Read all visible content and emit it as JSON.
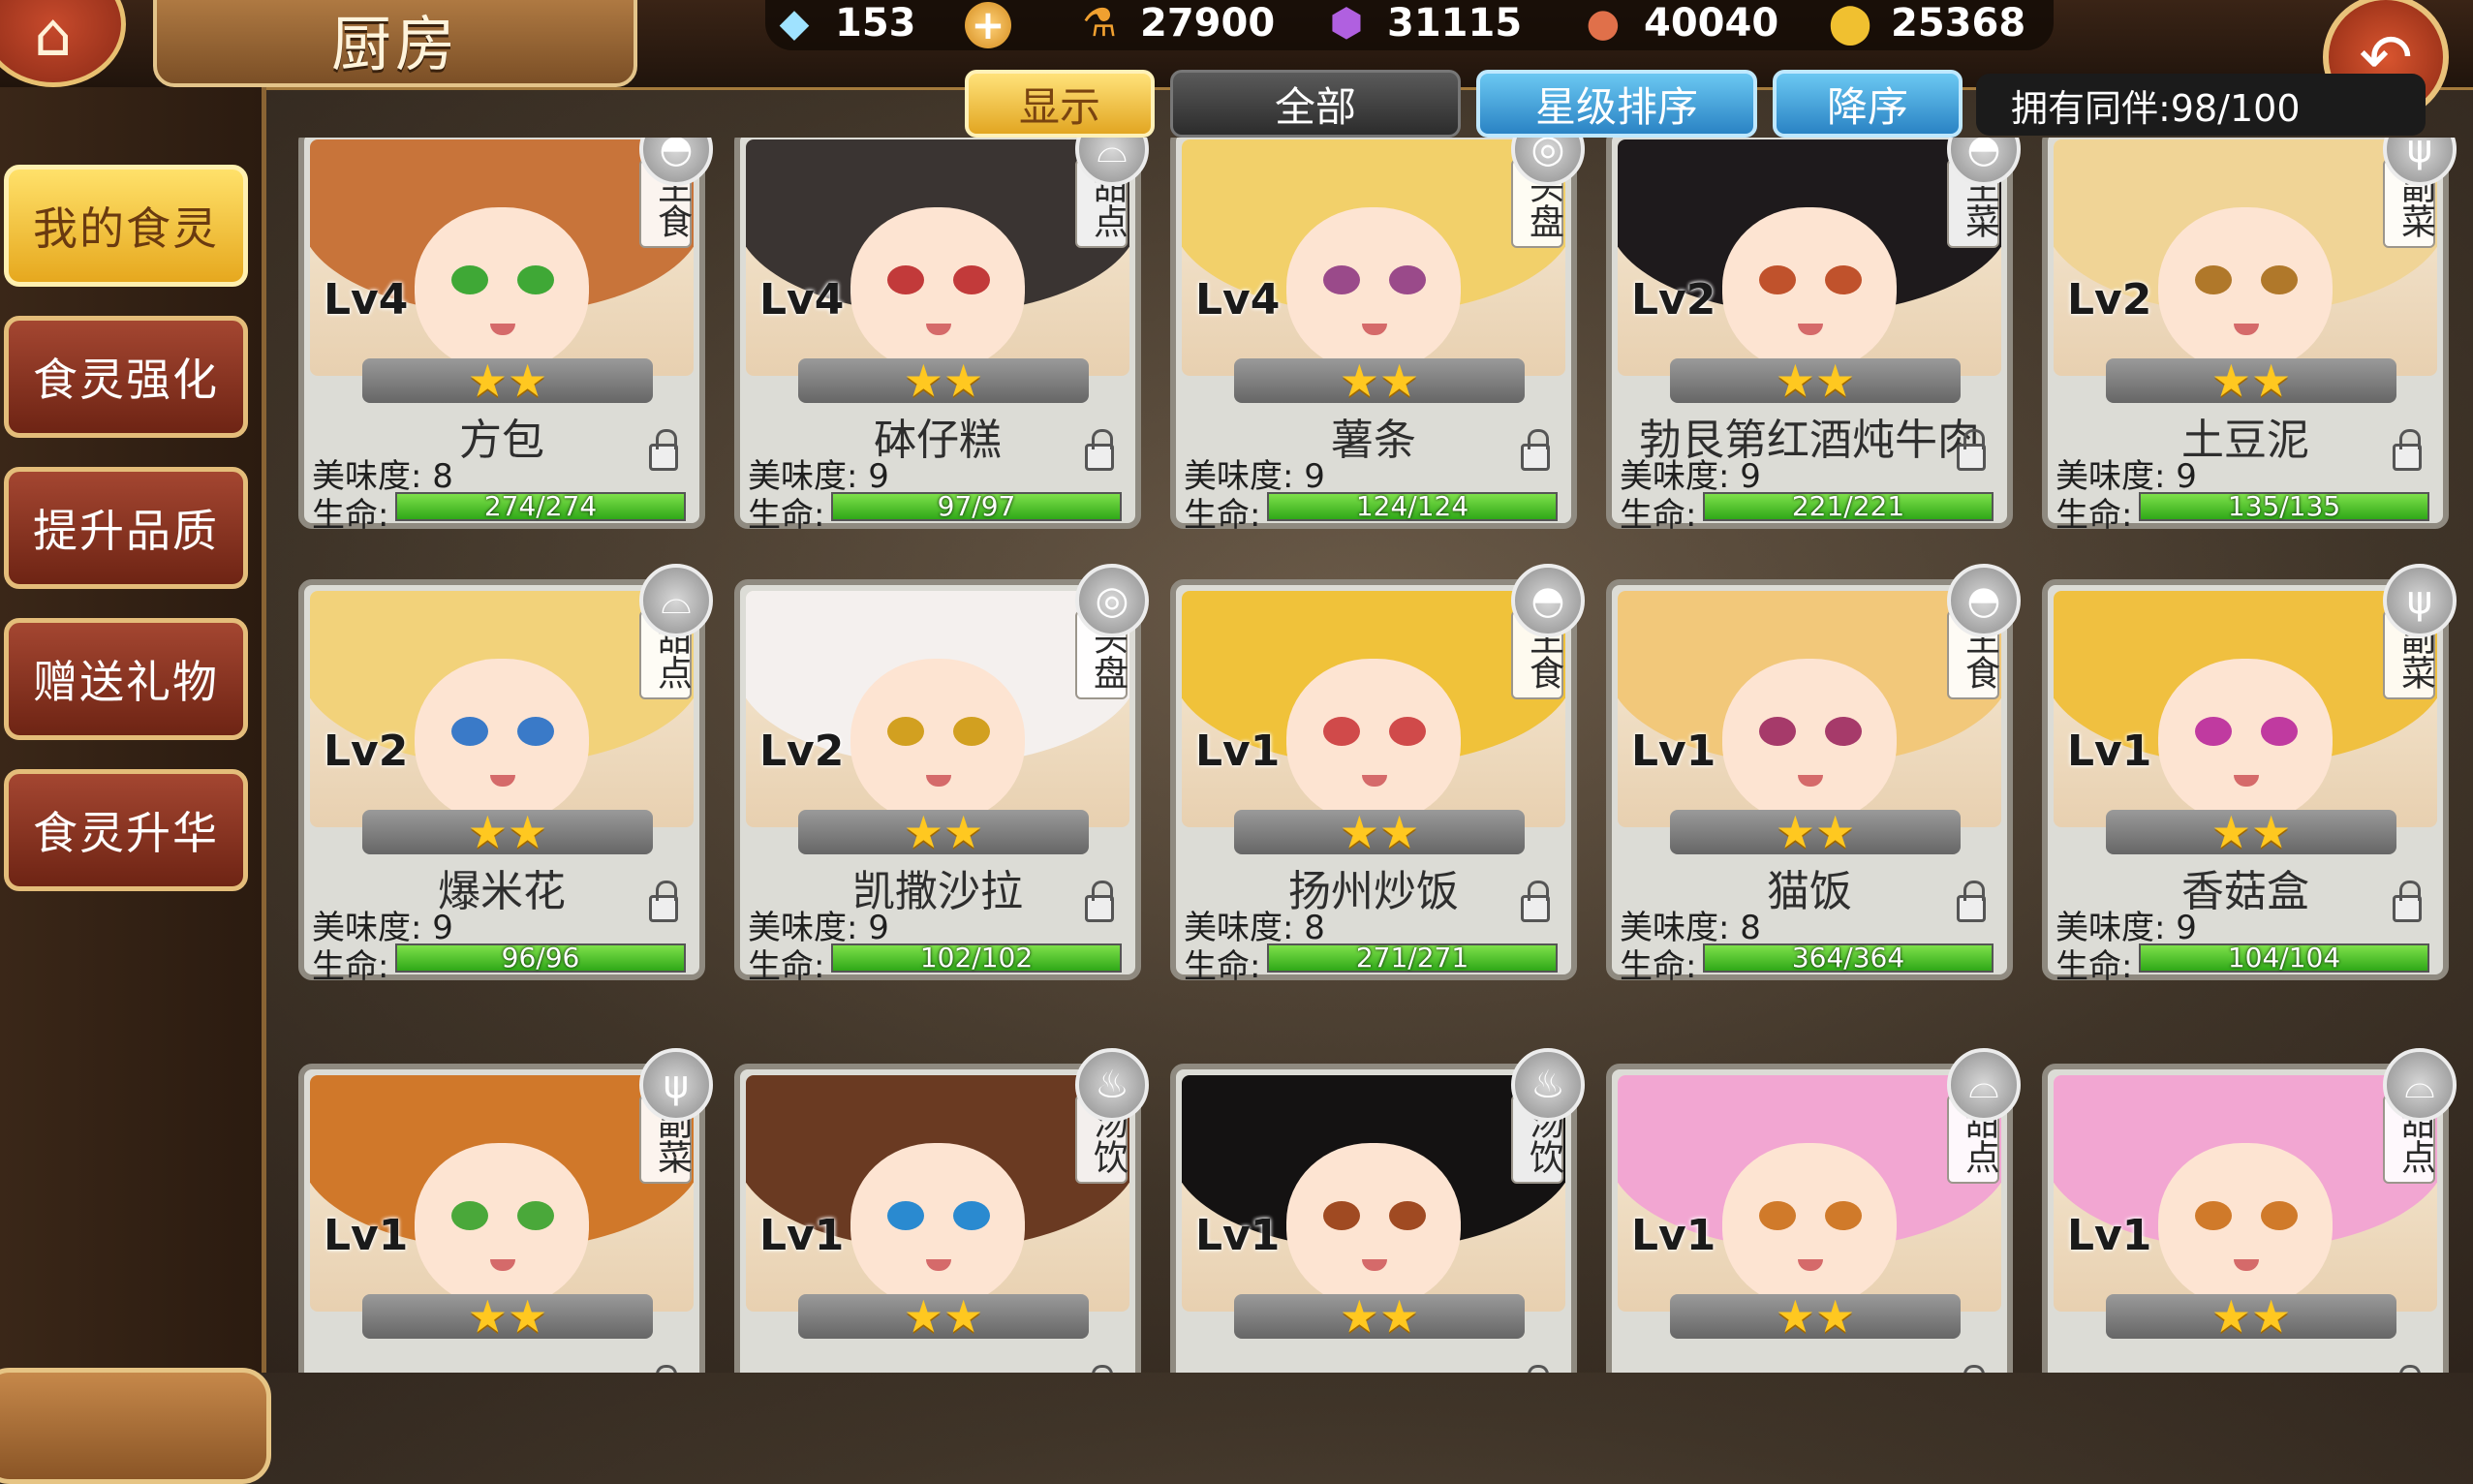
{
  "header": {
    "title": "厨房",
    "home_icon": "home-icon",
    "back_icon": "back-arrow-icon"
  },
  "resources": [
    {
      "name": "diamond",
      "icon": "diamond-icon",
      "value": "153"
    },
    {
      "name": "food-bag",
      "icon": "potion-icon",
      "value": "27900"
    },
    {
      "name": "crystal",
      "icon": "crystal-icon",
      "value": "31115"
    },
    {
      "name": "meat",
      "icon": "meat-icon",
      "value": "40040"
    },
    {
      "name": "stamina",
      "icon": "stamina-icon",
      "value": "25368"
    }
  ],
  "filters": {
    "show": "显示",
    "all": "全部",
    "star_sort": "星级排序",
    "descending": "降序",
    "owned": "拥有同伴:98/100"
  },
  "sidebar": [
    {
      "label": "我的食灵",
      "active": true
    },
    {
      "label": "食灵强化",
      "active": false
    },
    {
      "label": "提升品质",
      "active": false
    },
    {
      "label": "赠送礼物",
      "active": false
    },
    {
      "label": "食灵升华",
      "active": false
    }
  ],
  "labels": {
    "taste": "美味度:",
    "hp": "生命:"
  },
  "cards": [
    {
      "name": "方包",
      "level": "Lv4",
      "type": "主食",
      "stars": 2,
      "taste": "8",
      "hp": "274/274",
      "hp_frac": 1.0,
      "hair": "#c8743a",
      "eye": "#3fa836",
      "icon": "bowl-icon"
    },
    {
      "name": "砵仔糕",
      "level": "Lv4",
      "type": "甜点",
      "stars": 2,
      "taste": "9",
      "hp": "97/97",
      "hp_frac": 1.0,
      "hair": "#3a3432",
      "eye": "#c23a3a",
      "icon": "cake-icon"
    },
    {
      "name": "薯条",
      "level": "Lv4",
      "type": "头盘",
      "stars": 2,
      "taste": "9",
      "hp": "124/124",
      "hp_frac": 1.0,
      "hair": "#f2d06a",
      "eye": "#9a4a8a",
      "icon": "plate-icon"
    },
    {
      "name": "勃艮第红酒炖牛肉",
      "level": "Lv2",
      "type": "主菜",
      "stars": 2,
      "taste": "9",
      "hp": "221/221",
      "hp_frac": 1.0,
      "hair": "#1e1a1c",
      "eye": "#c0522c",
      "icon": "bowl-icon"
    },
    {
      "name": "土豆泥",
      "level": "Lv2",
      "type": "副菜",
      "stars": 2,
      "taste": "9",
      "hp": "135/135",
      "hp_frac": 1.0,
      "hair": "#f0d496",
      "eye": "#b0782a",
      "icon": "fork-icon"
    },
    {
      "name": "爆米花",
      "level": "Lv2",
      "type": "甜点",
      "stars": 2,
      "taste": "9",
      "hp": "96/96",
      "hp_frac": 1.0,
      "hair": "#f2d27a",
      "eye": "#3a7ac8",
      "icon": "cake-icon"
    },
    {
      "name": "凯撒沙拉",
      "level": "Lv2",
      "type": "头盘",
      "stars": 2,
      "taste": "9",
      "hp": "102/102",
      "hp_frac": 1.0,
      "hair": "#f4f0ee",
      "eye": "#d2a020",
      "icon": "plate-icon"
    },
    {
      "name": "扬州炒饭",
      "level": "Lv1",
      "type": "主食",
      "stars": 2,
      "taste": "8",
      "hp": "271/271",
      "hp_frac": 1.0,
      "hair": "#f0c23a",
      "eye": "#d04a4a",
      "icon": "bowl-icon"
    },
    {
      "name": "猫饭",
      "level": "Lv1",
      "type": "主食",
      "stars": 2,
      "taste": "8",
      "hp": "364/364",
      "hp_frac": 1.0,
      "hair": "#f2c87a",
      "eye": "#a63a6a",
      "icon": "bowl-icon"
    },
    {
      "name": "香菇盒",
      "level": "Lv1",
      "type": "副菜",
      "stars": 2,
      "taste": "9",
      "hp": "104/104",
      "hp_frac": 1.0,
      "hair": "#f0c040",
      "eye": "#c03aa0",
      "icon": "fork-icon"
    },
    {
      "name": "",
      "level": "Lv1",
      "type": "副菜",
      "stars": 2,
      "taste": "",
      "hp": "",
      "hp_frac": 1.0,
      "hair": "#d0782a",
      "eye": "#4aa83a",
      "icon": "fork-icon"
    },
    {
      "name": "",
      "level": "Lv1",
      "type": "汤饮",
      "stars": 2,
      "taste": "",
      "hp": "",
      "hp_frac": 1.0,
      "hair": "#6a3a22",
      "eye": "#2a8ad0",
      "icon": "soup-icon"
    },
    {
      "name": "",
      "level": "Lv1",
      "type": "汤饮",
      "stars": 2,
      "taste": "",
      "hp": "",
      "hp_frac": 1.0,
      "hair": "#141212",
      "eye": "#a04a22",
      "icon": "soup-icon"
    },
    {
      "name": "",
      "level": "Lv1",
      "type": "甜点",
      "stars": 2,
      "taste": "",
      "hp": "",
      "hp_frac": 1.0,
      "hair": "#f2a6d2",
      "eye": "#d07a2a",
      "icon": "cake-icon"
    },
    {
      "name": "",
      "level": "Lv1",
      "type": "甜点",
      "stars": 2,
      "taste": "",
      "hp": "",
      "hp_frac": 1.0,
      "hair": "#f2a6d2",
      "eye": "#d07a2a",
      "icon": "cake-icon"
    }
  ]
}
